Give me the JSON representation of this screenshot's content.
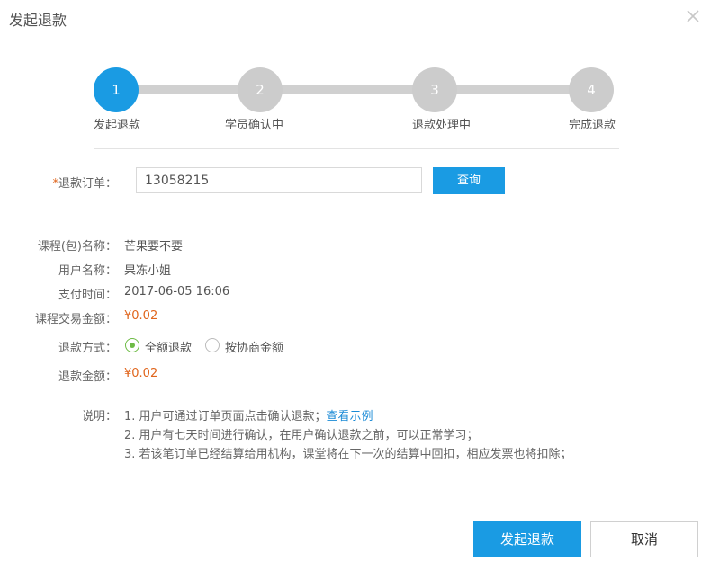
{
  "dialog": {
    "title": "发起退款",
    "close_icon": "close-icon"
  },
  "steps": [
    {
      "number": "1",
      "label": "发起退款",
      "active": true
    },
    {
      "number": "2",
      "label": "学员确认中",
      "active": false
    },
    {
      "number": "3",
      "label": "退款处理中",
      "active": false
    },
    {
      "number": "4",
      "label": "完成退款",
      "active": false
    }
  ],
  "order": {
    "required_mark": "*",
    "label": "退款订单：",
    "value": "13058215",
    "query_button": "查询"
  },
  "details": {
    "course_label": "课程(包)名称：",
    "course_value": "芒果要不要",
    "user_label": "用户名称：",
    "user_value": "果冻小姐",
    "time_label": "支付时间：",
    "time_value": "2017-06-05 16:06",
    "amount_label": "课程交易金额：",
    "amount_value": "¥0.02"
  },
  "refund": {
    "method_label": "退款方式：",
    "options": [
      {
        "label": "全额退款",
        "checked": true
      },
      {
        "label": "按协商金额",
        "checked": false
      }
    ],
    "amount_label": "退款金额：",
    "amount_value": "¥0.02"
  },
  "notes": {
    "label": "说明：",
    "line1": "1. 用户可通过订单页面点击确认退款；",
    "line1_link": "查看示例",
    "line2": "2. 用户有七天时间进行确认，在用户确认退款之前，可以正常学习；",
    "line3": "3. 若该笔订单已经结算给用机构，课堂将在下一次的结算中回扣，相应发票也将扣除；"
  },
  "footer": {
    "submit_button": "发起退款",
    "cancel_button": "取消"
  },
  "colors": {
    "primary": "#1a9be3",
    "price": "#e0651c",
    "radio_checked": "#6dbb45",
    "step_inactive": "#cccccc",
    "link": "#1a8ad6"
  }
}
